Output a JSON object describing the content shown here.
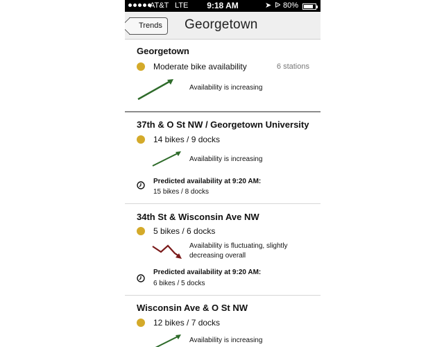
{
  "status_bar": {
    "carrier": "AT&T",
    "network": "LTE",
    "time": "9:18 AM",
    "battery": "80%",
    "battery_level": 0.8
  },
  "nav": {
    "back_label": "Trends",
    "title": "Georgetown"
  },
  "summary": {
    "name": "Georgetown",
    "availability": "Moderate bike availability",
    "stations": "6 stations",
    "trend": "Availability is increasing"
  },
  "stations": [
    {
      "name": "37th & O St NW / Georgetown University",
      "availability": "14 bikes / 9 docks",
      "trend": "Availability is increasing",
      "prediction_title": "Predicted availability at 9:20 AM:",
      "prediction_value": "15 bikes / 8 docks"
    },
    {
      "name": "34th St & Wisconsin Ave NW",
      "availability": "5 bikes / 6 docks",
      "trend": "Availability is fluctuating, slightly decreasing overall",
      "prediction_title": "Predicted availability at 9:20 AM:",
      "prediction_value": "6 bikes / 5 docks"
    },
    {
      "name": "Wisconsin Ave & O St NW",
      "availability": "12 bikes / 7 docks",
      "trend": "Availability is increasing"
    }
  ],
  "colors": {
    "availability_dot": "#d4aa2a",
    "trend_up": "#2e6b2a",
    "trend_down": "#7a1a1a"
  }
}
